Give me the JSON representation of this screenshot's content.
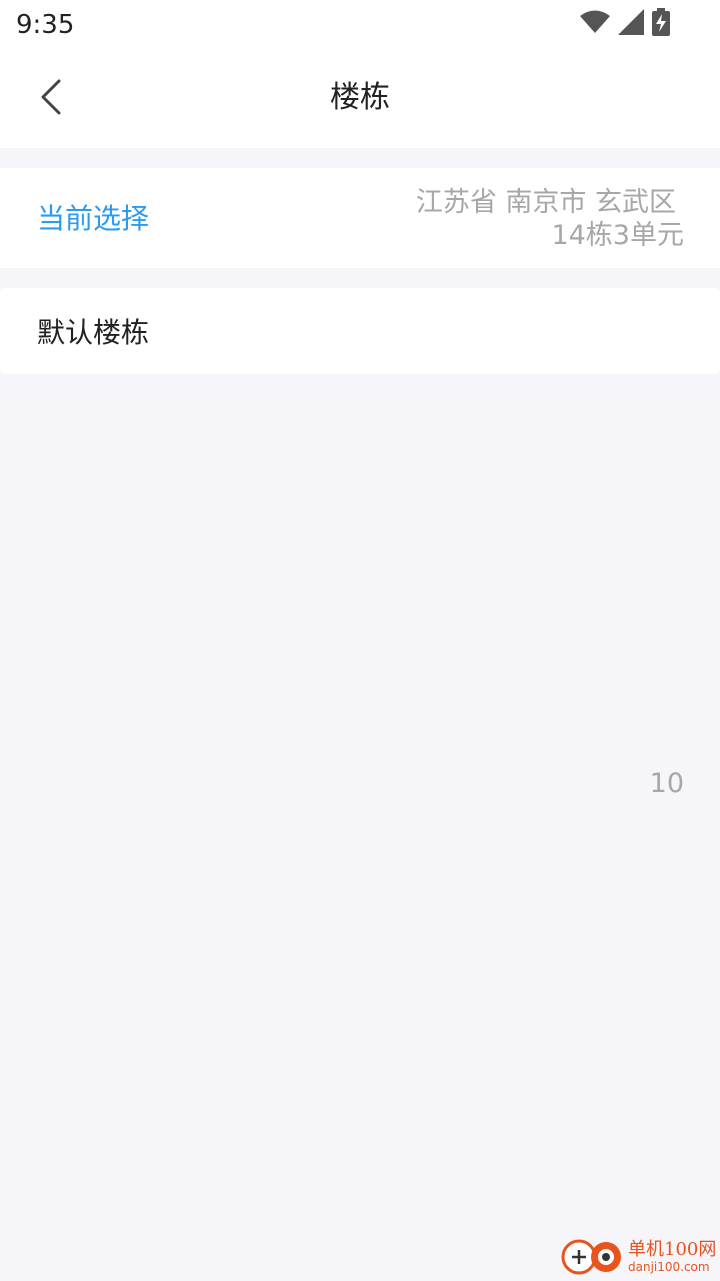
{
  "status_bar": {
    "time": "9:35",
    "icons": [
      "wifi-icon",
      "cell-signal-icon",
      "battery-charging-icon"
    ]
  },
  "app_bar": {
    "back_icon": "chevron-left-icon",
    "title": "楼栋"
  },
  "current_selection": {
    "label": "当前选择",
    "location": "江苏省 南京市 玄武区",
    "unit": "14栋3单元"
  },
  "building_list": {
    "items": [
      {
        "label": "默认楼栋"
      }
    ]
  },
  "index_label": "10",
  "watermark": {
    "brand_cn": "单机100网",
    "brand_url": "danji100.com"
  },
  "colors": {
    "accent": "#2b9bf0",
    "background": "#f5f5fa",
    "muted_text": "#a7a7a7",
    "watermark": "#e8541e"
  }
}
